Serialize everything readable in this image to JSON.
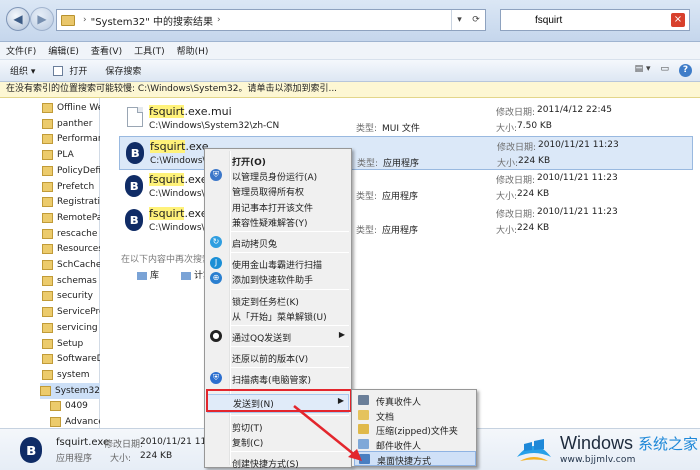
{
  "address": {
    "breadcrumb": "\"System32\" 中的搜索结果"
  },
  "search": {
    "value": "fsquirt"
  },
  "menubar": [
    "文件(F)",
    "编辑(E)",
    "查看(V)",
    "工具(T)",
    "帮助(H)"
  ],
  "cmdbar": {
    "organize": "组织 ▾",
    "open": "打开",
    "save_search": "保存搜索"
  },
  "infobar": "在没有索引的位置搜索可能较慢: C:\\Windows\\System32。请单击以添加到索引...",
  "nav_items": [
    {
      "label": "Offline We",
      "child": false
    },
    {
      "label": "panther",
      "child": false
    },
    {
      "label": "Performar",
      "child": false
    },
    {
      "label": "PLA",
      "child": false
    },
    {
      "label": "PolicyDefi",
      "child": false
    },
    {
      "label": "Prefetch",
      "child": false
    },
    {
      "label": "Registratic",
      "child": false
    },
    {
      "label": "RemotePa",
      "child": false
    },
    {
      "label": "rescache",
      "child": false
    },
    {
      "label": "Resources",
      "child": false
    },
    {
      "label": "SchCache",
      "child": false
    },
    {
      "label": "schemas",
      "child": false
    },
    {
      "label": "security",
      "child": false
    },
    {
      "label": "ServicePrc",
      "child": false
    },
    {
      "label": "servicing",
      "child": false
    },
    {
      "label": "Setup",
      "child": false
    },
    {
      "label": "SoftwareD",
      "child": false
    },
    {
      "label": "system",
      "child": false
    },
    {
      "label": "System32",
      "child": false,
      "selected": true
    },
    {
      "label": "0409",
      "child": true
    },
    {
      "label": "Advance",
      "child": true
    }
  ],
  "files": [
    {
      "name_hl": "fsquirt",
      "name_rest": ".exe.mui",
      "path": "C:\\Windows\\System32\\zh-CN",
      "type_label": "类型:",
      "type": "MUI 文件",
      "date_label": "修改日期:",
      "date": "2011/4/12 22:45",
      "size_label": "大小:",
      "size": "7.50 KB",
      "icon": "doc"
    },
    {
      "name_hl": "fsquirt",
      "name_rest": ".exe",
      "path": "C:\\Windows\\S",
      "type_label": "类型:",
      "type": "应用程序",
      "date_label": "修改日期:",
      "date": "2010/11/21 11:23",
      "size_label": "大小:",
      "size": "224 KB",
      "icon": "bt",
      "selected": true
    },
    {
      "name_hl": "fsquirt",
      "name_rest": ".exe",
      "path": "C:\\Windows\\S",
      "type_label": "类型:",
      "type": "应用程序",
      "date_label": "修改日期:",
      "date": "2010/11/21 11:23",
      "size_label": "大小:",
      "size": "224 KB",
      "icon": "bt"
    },
    {
      "name_hl": "fsquirt",
      "name_rest": ".exe",
      "path": "C:\\Windows\\S",
      "type_label": "类型:",
      "type": "应用程序",
      "date_label": "修改日期:",
      "date": "2010/11/21 11:23",
      "size_label": "大小:",
      "size": "224 KB",
      "icon": "bt"
    }
  ],
  "search_again": "在以下内容中再次搜索",
  "search_locations": [
    "库",
    "计算机"
  ],
  "details": {
    "name": "fsquirt.exe",
    "modified_label": "修改日期:",
    "modified": "2010/11/21 11:23",
    "type": "应用程序",
    "size_label": "大小:",
    "size": "224 KB"
  },
  "context_menu": [
    {
      "label": "打开(O)",
      "bold": true
    },
    {
      "label": "以管理员身份运行(A)",
      "icon": "shield"
    },
    {
      "label": "管理员取得所有权"
    },
    {
      "label": "用记事本打开该文件"
    },
    {
      "label": "兼容性疑难解答(Y)"
    },
    {
      "sep": true
    },
    {
      "label": "启动拷贝兔",
      "icon": "copy"
    },
    {
      "sep": true
    },
    {
      "label": "使用金山毒霸进行扫描",
      "icon": "kav"
    },
    {
      "label": "添加到快速软件助手",
      "icon": "helper"
    },
    {
      "sep": true
    },
    {
      "label": "锁定到任务栏(K)"
    },
    {
      "label": "从「开始」菜单解锁(U)"
    },
    {
      "sep": true
    },
    {
      "label": "通过QQ发送到",
      "icon": "qq",
      "arrow": true
    },
    {
      "sep": true
    },
    {
      "label": "还原以前的版本(V)"
    },
    {
      "sep": true
    },
    {
      "label": "扫描病毒(电脑管家)",
      "icon": "guard"
    },
    {
      "sep": true
    },
    {
      "label": "发送到(N)",
      "arrow": true,
      "highlighted": true
    },
    {
      "sep": true
    },
    {
      "label": "剪切(T)"
    },
    {
      "label": "复制(C)"
    },
    {
      "sep": true
    },
    {
      "label": "创建快捷方式(S)"
    }
  ],
  "submenu": [
    {
      "label": "传真收件人",
      "color": "#6b7f99"
    },
    {
      "label": "文档",
      "color": "#e5c35d"
    },
    {
      "label": "压缩(zipped)文件夹",
      "color": "#e0b94a"
    },
    {
      "label": "邮件收件人",
      "color": "#7fa8d8"
    },
    {
      "label": "桌面快捷方式",
      "color": "#4a7fc1",
      "highlighted": true
    }
  ],
  "watermark": {
    "brand": "Windows",
    "cn": "系统之家",
    "url": "www.bjjmlv.com"
  },
  "colors": {
    "accent": "#3e7cc8",
    "highlight_box": "#e3262d",
    "search_highlight": "#fff27a"
  }
}
